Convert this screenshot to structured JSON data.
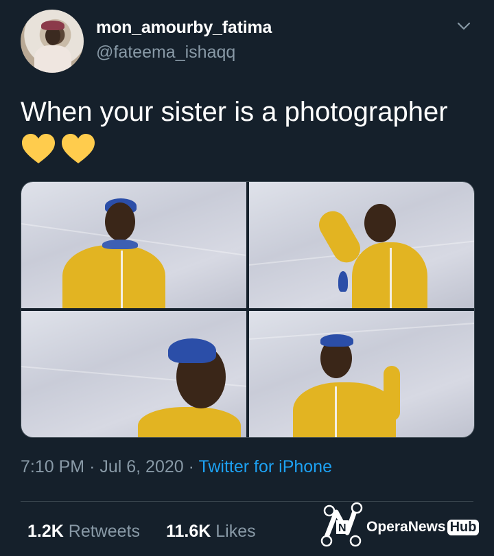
{
  "tweet": {
    "display_name": "mon_amourby_fatima",
    "handle": "@fateema_ishaqq",
    "text": "When your sister is a photographer",
    "emoji": [
      "yellow-heart",
      "yellow-heart"
    ],
    "photos_count": 4,
    "time": "7:10 PM",
    "date": "Jul 6, 2020",
    "separator": "·",
    "source": "Twitter for iPhone"
  },
  "stats": {
    "retweets_count": "1.2K",
    "retweets_label": "Retweets",
    "likes_count": "11.6K",
    "likes_label": "Likes"
  },
  "watermark": {
    "brand": "OperaNews",
    "badge": "Hub"
  },
  "colors": {
    "background": "#15202b",
    "muted": "#8899a6",
    "link": "#1da1f2",
    "heart": "#ffcc4d"
  }
}
